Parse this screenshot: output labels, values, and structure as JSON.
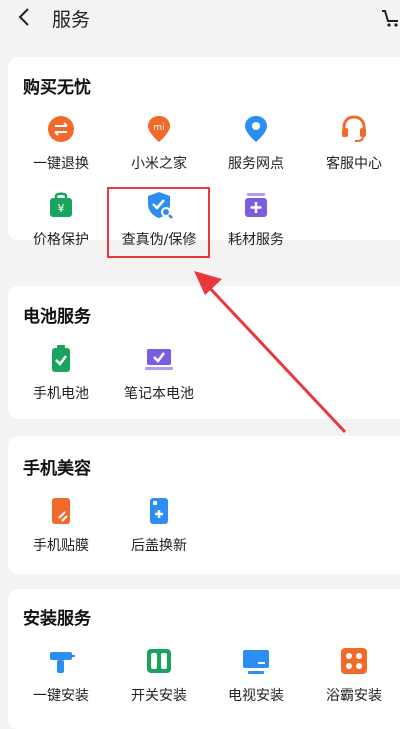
{
  "header": {
    "back_icon": "chevron-left-icon",
    "title": "服务",
    "cart_icon": "cart-icon"
  },
  "sections": [
    {
      "title": "购买无忧",
      "items": [
        {
          "label": "一键退换",
          "icon": "exchange-icon",
          "color": "#f26a2b"
        },
        {
          "label": "小米之家",
          "icon": "mi-store-pin-icon",
          "color": "#f26a2b"
        },
        {
          "label": "服务网点",
          "icon": "location-pin-icon",
          "color": "#2d8ef2"
        },
        {
          "label": "客服中心",
          "icon": "headset-icon",
          "color": "#f26a2b"
        },
        {
          "label": "价格保护",
          "icon": "price-bag-icon",
          "color": "#1aa35c"
        },
        {
          "label": "查真伪/保修",
          "icon": "shield-search-icon",
          "color": "#2d8ef2"
        },
        {
          "label": "耗材服务",
          "icon": "consumables-box-icon",
          "color": "#7c5ce0"
        }
      ]
    },
    {
      "title": "电池服务",
      "items": [
        {
          "label": "手机电池",
          "icon": "phone-battery-icon",
          "color": "#1aa35c"
        },
        {
          "label": "笔记本电池",
          "icon": "laptop-battery-icon",
          "color": "#7c5ce0"
        }
      ]
    },
    {
      "title": "手机美容",
      "items": [
        {
          "label": "手机贴膜",
          "icon": "screen-film-icon",
          "color": "#f26a2b"
        },
        {
          "label": "后盖换新",
          "icon": "back-cover-icon",
          "color": "#2d8ef2"
        }
      ]
    },
    {
      "title": "安装服务",
      "items": [
        {
          "label": "一键安装",
          "icon": "drill-icon",
          "color": "#2d8ef2"
        },
        {
          "label": "开关安装",
          "icon": "switch-icon",
          "color": "#1aa35c"
        },
        {
          "label": "电视安装",
          "icon": "tv-icon",
          "color": "#2d8ef2"
        },
        {
          "label": "浴霸安装",
          "icon": "bath-heater-icon",
          "color": "#f26a2b"
        }
      ]
    }
  ],
  "annotation": {
    "color": "#e8383d"
  }
}
